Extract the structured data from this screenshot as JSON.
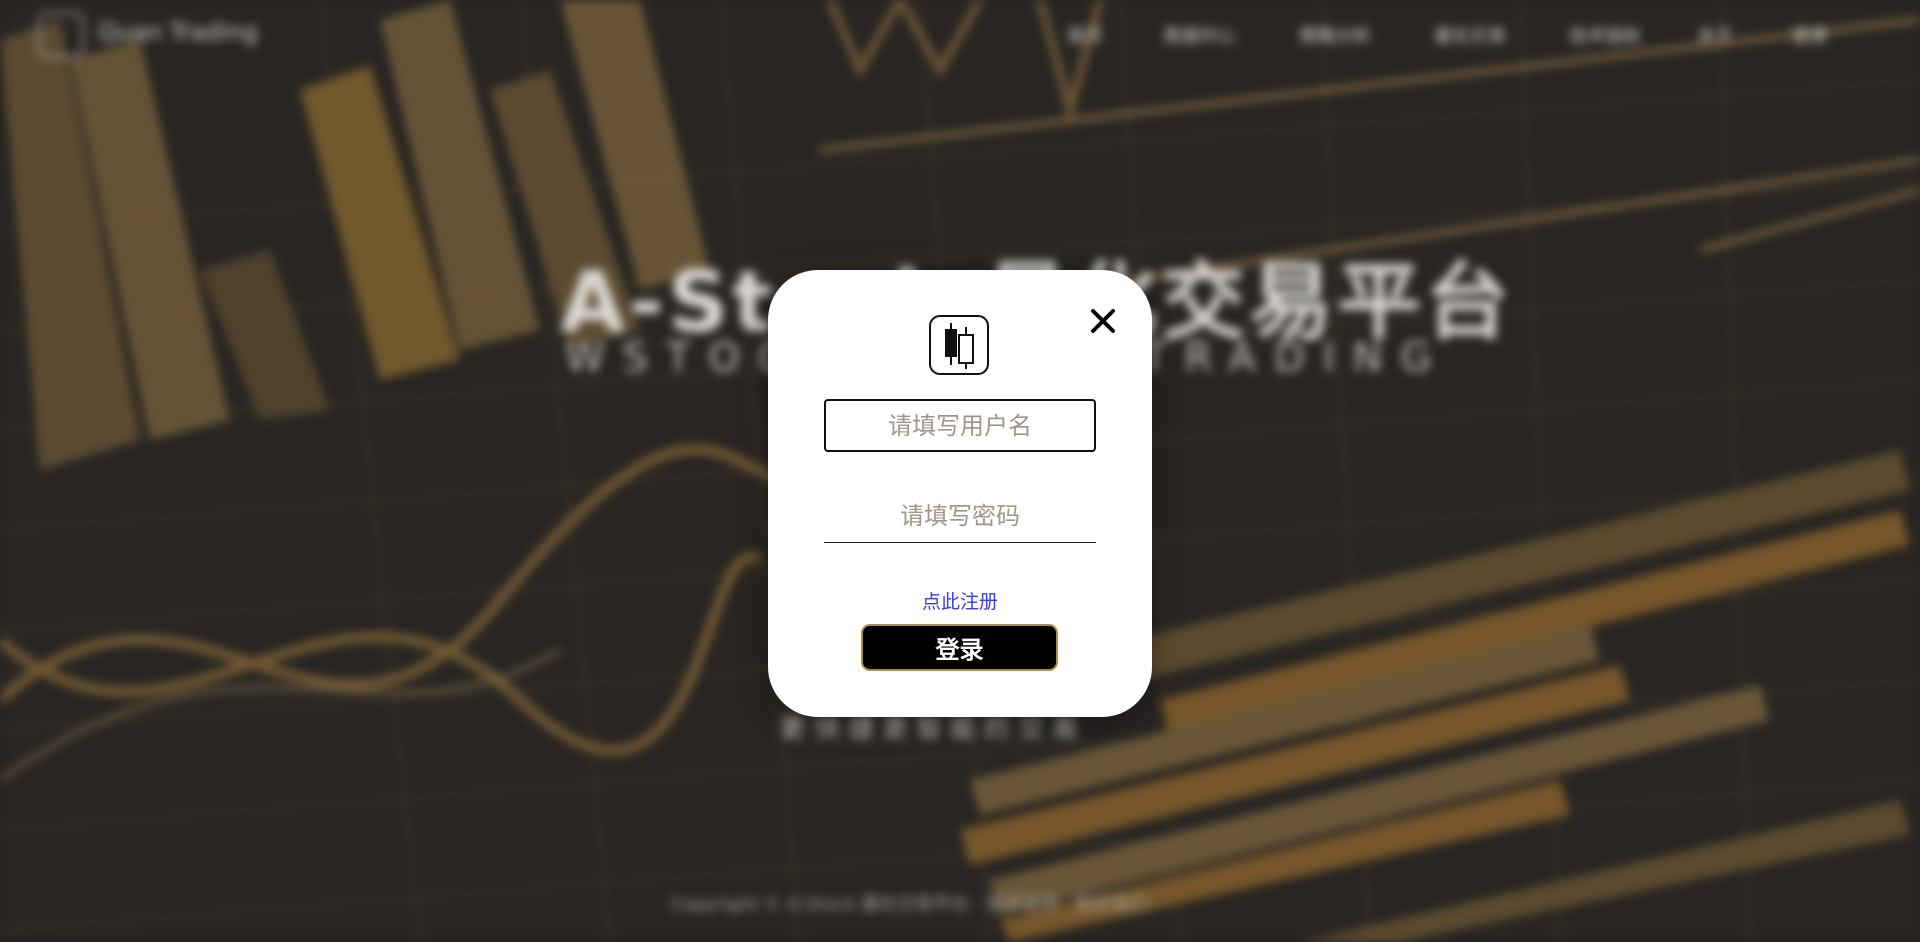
{
  "nav": {
    "logo_text": "Quan Trading",
    "items": [
      "首页",
      "数据中心",
      "策略分析",
      "量化交易",
      "技术指标",
      "关于",
      "登录"
    ]
  },
  "hero": {
    "title": "A-Stock 量化交易平台",
    "subtitle": "WSTOCK QUANT TRADING",
    "tagline": "更快捷更智能的交易",
    "footer": "Copyright © A-Stock 量化交易平台 · 技术支持 · 联系我们"
  },
  "login_modal": {
    "username_placeholder": "请填写用户名",
    "password_placeholder": "请填写密码",
    "register_link": "点此注册",
    "login_button": "登录",
    "close_symbol": "×"
  },
  "colors": {
    "accent_gold": "#b08a4e",
    "link_blue": "#3b3fd6",
    "modal_bg": "#ffffff",
    "page_bg": "#2a2724"
  }
}
